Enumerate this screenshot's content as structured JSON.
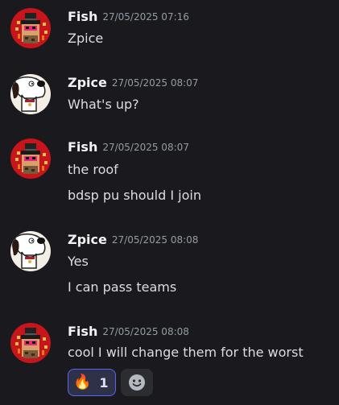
{
  "users": {
    "fish": {
      "name": "Fish",
      "avatar_icon": "pixel-sprite-with-hat-avatar",
      "avatar_bg": "#c8151b"
    },
    "zpice": {
      "name": "Zpice",
      "avatar_icon": "white-dog-cartoon-avatar",
      "avatar_bg": "#f4efe6"
    }
  },
  "messages": [
    {
      "author": "Fish",
      "timestamp": "27/05/2025 07:16",
      "lines": [
        "Zpice"
      ]
    },
    {
      "author": "Zpice",
      "timestamp": "27/05/2025 08:07",
      "lines": [
        "What's up?"
      ]
    },
    {
      "author": "Fish",
      "timestamp": "27/05/2025 08:07",
      "lines": [
        "the roof",
        "bdsp pu should I join"
      ]
    },
    {
      "author": "Zpice",
      "timestamp": "27/05/2025 08:08",
      "lines": [
        "Yes",
        "I can pass teams"
      ]
    },
    {
      "author": "Fish",
      "timestamp": "27/05/2025 08:08",
      "lines": [
        "cool I will change them for the worst"
      ],
      "reactions": [
        {
          "emoji": "🔥",
          "count": "1"
        }
      ],
      "add_reaction_icon": "smiley-add-reaction-icon"
    }
  ],
  "colors": {
    "background": "#1a1a1e",
    "username": "#f2f3f5",
    "timestamp": "#949ba4",
    "message_text": "#dbdee1",
    "reaction_bg": "#2e3147",
    "reaction_border": "#5865f2"
  }
}
